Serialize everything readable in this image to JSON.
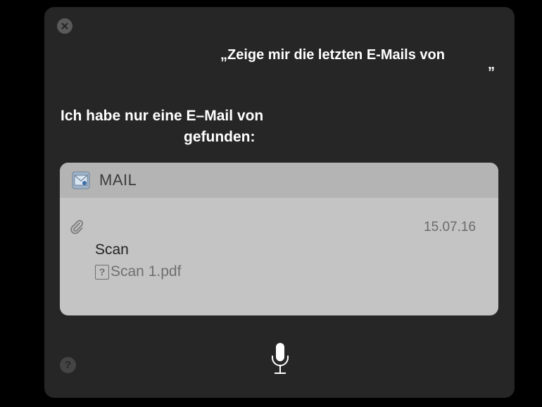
{
  "query": {
    "text": "„Zeige mir die letzten E-Mails von",
    "close_quote": "”"
  },
  "response": {
    "line1": "Ich habe nur eine E–Mail von",
    "line2": "gefunden:"
  },
  "mail_card": {
    "app_name": "MAIL",
    "app_icon": "mail-app-icon",
    "date": "15.07.16",
    "subject": "Scan",
    "attachment_name": "Scan 1.pdf",
    "attachment_icon_glyph": "?"
  },
  "controls": {
    "close_icon": "close-icon",
    "mic_icon": "microphone-icon",
    "help_glyph": "?"
  },
  "colors": {
    "background": "#000000",
    "panel": "#262626",
    "card": "#c4c4c4",
    "card_header": "#b4b4b4"
  }
}
